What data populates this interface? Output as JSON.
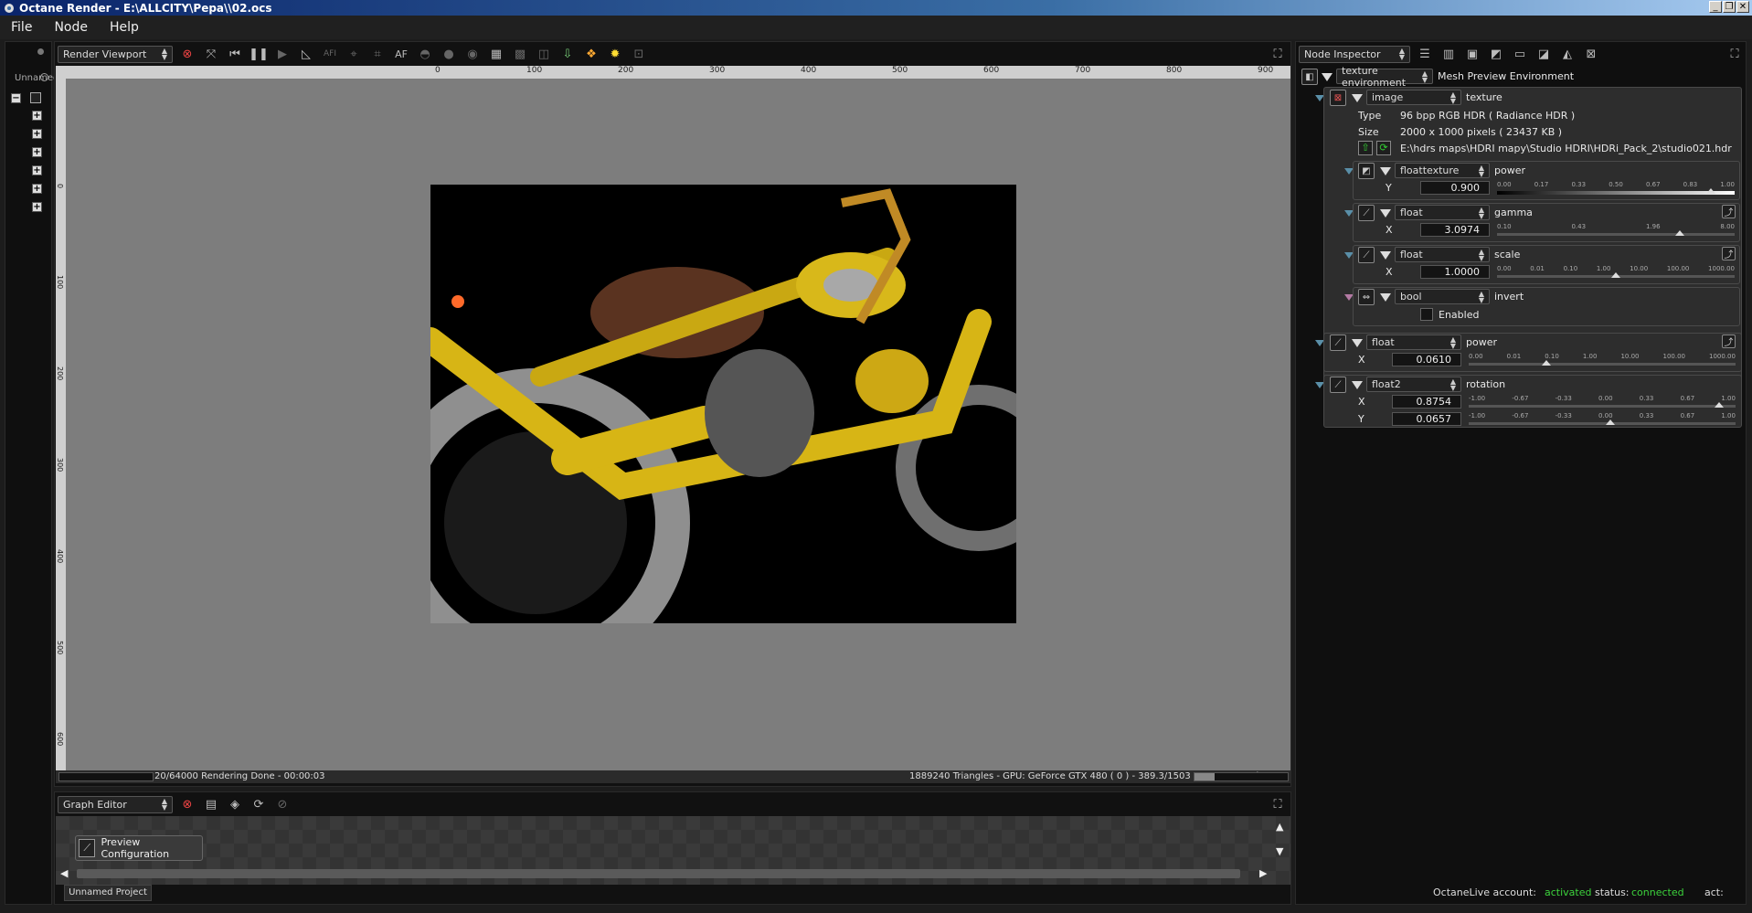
{
  "window": {
    "title": "Octane Render - E:\\ALLCITY\\Pepa\\\\02.ocs"
  },
  "menu": [
    "File",
    "Node",
    "Help"
  ],
  "left_panel": {
    "tab_label": "Unnamed"
  },
  "viewport": {
    "dropdown": "Render Viewport",
    "toolbar_af": "AF",
    "toolbar_afi": "AFI",
    "ruler_h": [
      "0",
      "100",
      "200",
      "300",
      "400",
      "500",
      "600",
      "700",
      "800",
      "900"
    ],
    "ruler_v": [
      "0",
      "100",
      "200",
      "300",
      "400",
      "500",
      "600"
    ],
    "status_left": "20/64000 Rendering Done - 00:00:03",
    "status_right": "1889240 Triangles - GPU: GeForce GTX 480 ( 0 ) - 389.3/1503 MB Mem Used",
    "render_colors": {
      "background": "#000000",
      "frame": "#d7b515",
      "tire": "#8f8f8f"
    }
  },
  "graph_editor": {
    "dropdown": "Graph Editor",
    "node_label": "Preview Configuration",
    "project_tab": "Unnamed Project"
  },
  "inspector": {
    "dropdown": "Node Inspector",
    "env_select": "texture environment",
    "env_name": "Mesh Preview Environment",
    "image": {
      "type_select": "image",
      "name": "texture",
      "type_label": "Type",
      "type_value": "96 bpp RGB HDR ( Radiance HDR )",
      "size_label": "Size",
      "size_value": "2000 x 1000 pixels ( 23437 KB )",
      "path": "E:\\hdrs maps\\HDRI mapy\\Studio HDRI\\HDRi_Pack_2\\studio021.hdr"
    },
    "sub_power": {
      "type": "floattexture",
      "name": "power",
      "axis": "Y",
      "value": "0.900",
      "ticks": [
        "0.00",
        "0.17",
        "0.33",
        "0.50",
        "0.67",
        "0.83",
        "1.00"
      ],
      "level": 0.9
    },
    "gamma": {
      "type": "float",
      "name": "gamma",
      "axis": "X",
      "value": "3.0974",
      "ticks": [
        "0.10",
        "0.43",
        "1.96",
        "8.00"
      ],
      "level": 0.77
    },
    "scale": {
      "type": "float",
      "name": "scale",
      "axis": "X",
      "value": "1.0000",
      "ticks": [
        "0.00",
        "0.01",
        "0.10",
        "1.00",
        "10.00",
        "100.00",
        "1000.00"
      ],
      "level": 0.5
    },
    "invert": {
      "type": "bool",
      "name": "invert",
      "checkbox_label": "Enabled"
    },
    "power": {
      "type": "float",
      "name": "power",
      "axis": "X",
      "value": "0.0610",
      "ticks": [
        "0.00",
        "0.01",
        "0.10",
        "1.00",
        "10.00",
        "100.00",
        "1000.00"
      ],
      "level": 0.29
    },
    "rotation": {
      "type": "float2",
      "name": "rotation",
      "x_label": "X",
      "x_value": "0.8754",
      "x_level": 0.94,
      "y_label": "Y",
      "y_value": "0.0657",
      "y_level": 0.53,
      "ticks": [
        "-1.00",
        "-0.67",
        "-0.33",
        "0.00",
        "0.33",
        "0.67",
        "1.00"
      ]
    }
  },
  "status": {
    "account_label": "OctaneLive account:",
    "account_value": "activated",
    "status_label": "status:",
    "status_value": "connected",
    "act_label": "act:",
    "ok_color": "#3cd33c"
  }
}
